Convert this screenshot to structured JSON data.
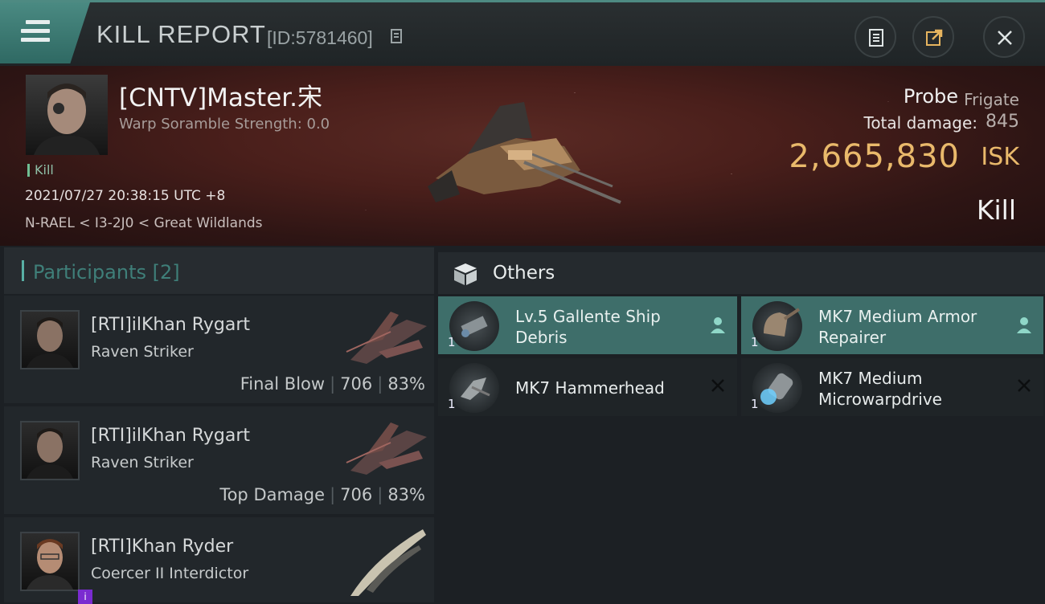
{
  "header": {
    "title": "KILL REPORT",
    "report_id": "[ID:5781460]",
    "buttons": [
      "clipboard-icon",
      "share-icon",
      "close-icon"
    ]
  },
  "victim": {
    "name": "[CNTV]Master.宋",
    "warp_scramble": "Warp Soramble Strength: 0.0",
    "tag": "Kill",
    "datetime": "2021/07/27 20:38:15 UTC +8",
    "location": "N-RAEL < I3-2J0 < Great Wildlands",
    "ship_name": "Probe",
    "ship_class": "Frigate",
    "total_damage_label": "Total damage:",
    "total_damage": "845",
    "isk_value": "2,665,830",
    "isk_unit": "ISK",
    "result": "Kill"
  },
  "participants": {
    "title": "Participants",
    "count": "[2]",
    "rows": [
      {
        "name": "[RTI]ilKhan Rygart",
        "ship": "Raven Striker",
        "role": "Final Blow",
        "damage": "706",
        "percent": "83%"
      },
      {
        "name": "[RTI]ilKhan Rygart",
        "ship": "Raven Striker",
        "role": "Top Damage",
        "damage": "706",
        "percent": "83%"
      },
      {
        "name": "[RTI]Khan Ryder",
        "ship": "Coercer II Interdictor",
        "badge": "i"
      }
    ]
  },
  "others": {
    "title": "Others",
    "items": [
      {
        "name": "Lv.5 Gallente Ship Debris",
        "qty": "1",
        "status": "dropped"
      },
      {
        "name": "MK7 Medium Armor Repairer",
        "qty": "1",
        "status": "dropped"
      },
      {
        "name": "MK7  Hammerhead",
        "qty": "1",
        "status": "destroyed"
      },
      {
        "name": "MK7 Medium Microwarpdrive",
        "qty": "1",
        "status": "destroyed"
      }
    ]
  },
  "colors": {
    "accent": "#4e8a82",
    "isk": "#e9b96b",
    "highlight_item": "#3e6e6a"
  }
}
